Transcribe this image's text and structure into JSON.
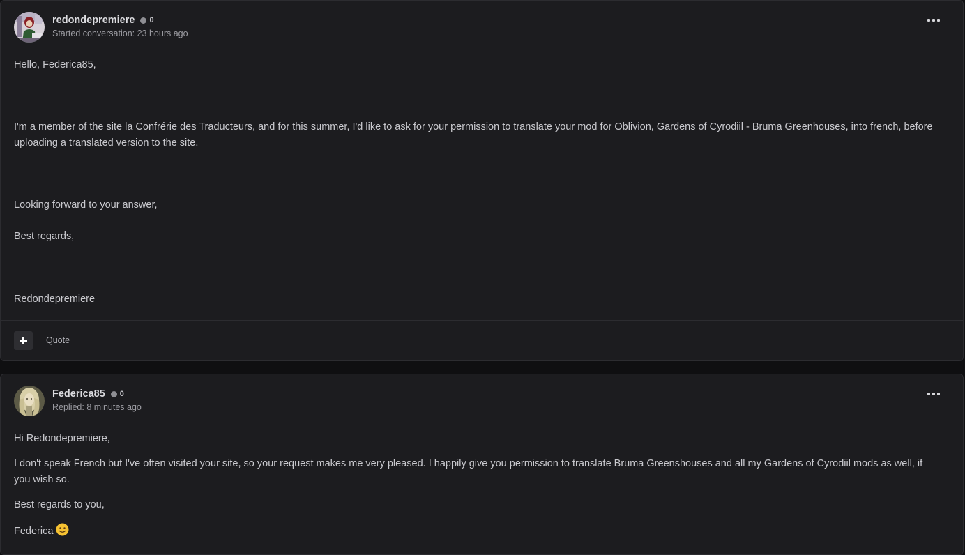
{
  "posts": [
    {
      "author": "redondepremiere",
      "reputation": "0",
      "meta": "Started conversation: 23 hours ago",
      "paragraphs": [
        "Hello, Federica85,",
        "I'm a member of the site la Confrérie des Traducteurs, and for this summer, I'd like to ask for your permission to translate your mod for Oblivion, Gardens of Cyrodiil - Bruma Greenhouses, into french, before uploading a translated version to the site.",
        "Looking forward to your answer,",
        "Best regards,",
        "Redondepremiere"
      ],
      "quote_label": "Quote",
      "add_icon": "plus-icon",
      "menu_icon": "ellipsis-icon"
    },
    {
      "author": "Federica85",
      "reputation": "0",
      "meta": "Replied: 8 minutes ago",
      "paragraphs": [
        "Hi Redondepremiere,",
        "I don't speak French but I've often visited your site, so your request makes me very pleased. I happily give you permission to translate Bruma Greenshouses and all my Gardens of Cyrodiil mods as well, if you wish so.",
        "Best regards to you,",
        "Federica"
      ],
      "signature_emoji": "slightly-smiling-face-icon",
      "menu_icon": "ellipsis-icon"
    }
  ],
  "colors": {
    "page_background": "#0f0f11",
    "card_background": "#1c1c1f",
    "border": "#2c2c30",
    "text": "#c9c9ce",
    "muted_text": "#9d9da3",
    "reputation_dot": "#8e8e93"
  }
}
